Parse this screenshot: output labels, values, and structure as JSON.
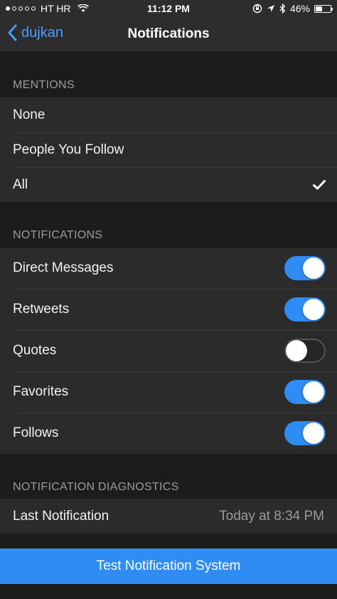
{
  "status_bar": {
    "signal_dots": [
      true,
      false,
      false,
      false,
      false
    ],
    "carrier": "HT HR",
    "time": "11:12 PM",
    "battery": "46%",
    "battery_level": 0.46
  },
  "nav": {
    "back_label": "dujkan",
    "title": "Notifications"
  },
  "mentions": {
    "header": "MENTIONS",
    "options": [
      {
        "label": "None",
        "selected": false
      },
      {
        "label": "People You Follow",
        "selected": false
      },
      {
        "label": "All",
        "selected": true
      }
    ]
  },
  "notifications": {
    "header": "NOTIFICATIONS",
    "items": [
      {
        "label": "Direct Messages",
        "on": true
      },
      {
        "label": "Retweets",
        "on": true
      },
      {
        "label": "Quotes",
        "on": false
      },
      {
        "label": "Favorites",
        "on": true
      },
      {
        "label": "Follows",
        "on": true
      }
    ]
  },
  "diagnostics": {
    "header": "NOTIFICATION DIAGNOSTICS",
    "last_label": "Last Notification",
    "last_value": "Today at 8:34 PM"
  },
  "action": {
    "label": "Test Notification System"
  },
  "colors": {
    "accent": "#2f8cf3",
    "link": "#4a9eff",
    "background": "#1c1c1c",
    "cell": "#2b2b2b"
  }
}
